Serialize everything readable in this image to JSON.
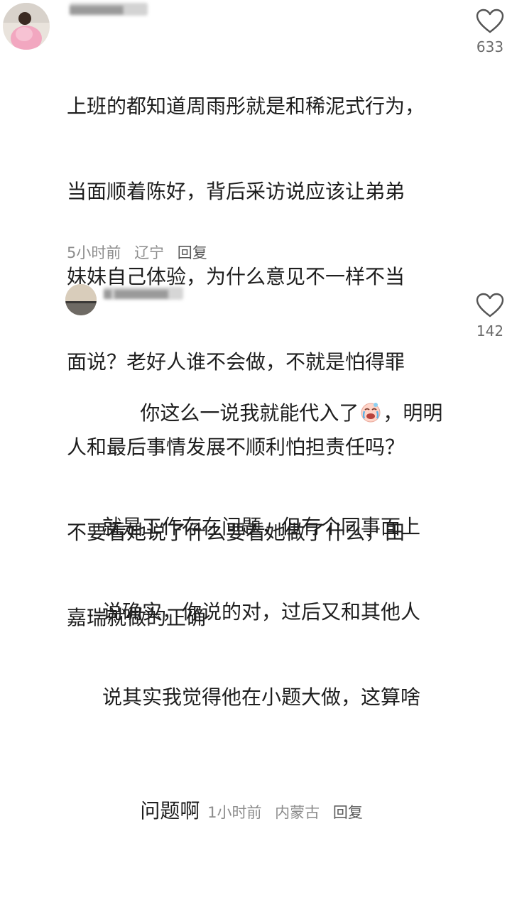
{
  "comments": [
    {
      "username": "▆▆▆▆▆▆▆",
      "text_lines": [
        "上班的都知道周雨彤就是和稀泥式行为，",
        "当面顺着陈好，背后采访说应该让弟弟",
        "妹妹自己体验，为什么意见不一样不当",
        "面说？老好人谁不会做，不就是怕得罪",
        "人和最后事情发展不顺利怕担责任吗？",
        "不要看她说了什么要看她做了什么，田",
        "嘉瑞就做的正确"
      ],
      "time": "5小时前",
      "location": "辽宁",
      "reply_label": "回复",
      "like_count": "633",
      "like_icon": "heart-outline-icon"
    },
    {
      "username": "▆ ▆▆▆▆▆▆▆",
      "text_line1_a": "你这么一说我就能代入了",
      "emoji": "crying-face-emoji",
      "text_line1_b": "，明明",
      "text_lines": [
        "就是工作存在问题，但有个同事面上",
        "说确实，你说的对，过后又和其他人",
        "说其实我觉得他在小题大做，这算啥"
      ],
      "text_last": "问题啊",
      "time": "1小时前",
      "location": "内蒙古",
      "reply_label": "回复",
      "like_count": "142",
      "like_icon": "heart-outline-icon"
    }
  ]
}
